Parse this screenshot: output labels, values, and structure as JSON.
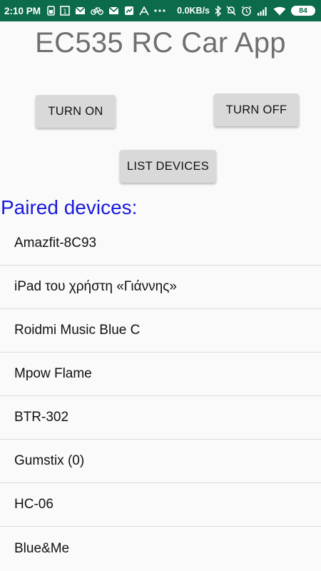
{
  "status_bar": {
    "time": "2:10 PM",
    "network_speed": "0.0KB/s",
    "battery_level": "84",
    "bg_color": "#0b6b4a",
    "left_icons": [
      "sim-icon",
      "notification-1-icon",
      "mail-icon",
      "bike-icon",
      "mail-icon",
      "gallery-icon",
      "font-icon",
      "more-icon"
    ],
    "right_icons": [
      "bluetooth-icon",
      "mute-icon",
      "alarm-icon",
      "signal-icon",
      "wifi-icon",
      "battery-icon"
    ]
  },
  "app": {
    "title": "EC535 RC Car App",
    "turn_on_label": "TURN ON",
    "turn_off_label": "TURN OFF",
    "list_devices_label": "LIST DEVICES",
    "paired_title": "Paired devices:",
    "paired_title_color": "#1a1ae0"
  },
  "devices": [
    "Amazfit-8C93",
    "iPad του χρήστη «Γιάννης»",
    "Roidmi Music Blue C",
    "Mpow Flame",
    "BTR-302",
    "Gumstix (0)",
    "HC-06",
    "Blue&Me"
  ]
}
